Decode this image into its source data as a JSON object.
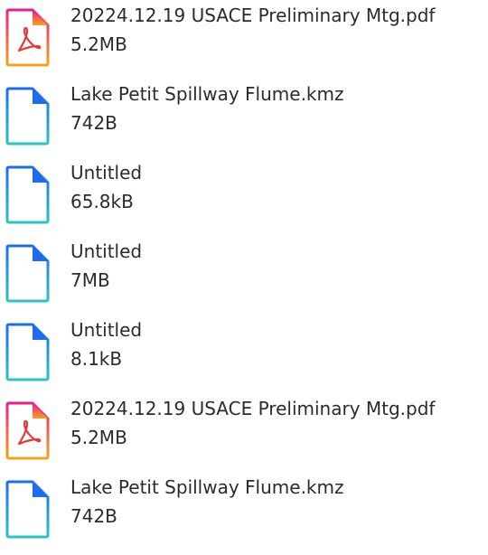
{
  "files": [
    {
      "name": "20224.12.19 USACE Preliminary Mtg.pdf",
      "size": "5.2MB",
      "icon": "pdf-file-icon"
    },
    {
      "name": "Lake Petit Spillway Flume.kmz",
      "size": "742B",
      "icon": "generic-file-icon"
    },
    {
      "name": "Untitled",
      "size": "65.8kB",
      "icon": "generic-file-icon"
    },
    {
      "name": "Untitled",
      "size": "7MB",
      "icon": "generic-file-icon"
    },
    {
      "name": "Untitled",
      "size": "8.1kB",
      "icon": "generic-file-icon"
    },
    {
      "name": "20224.12.19 USACE Preliminary Mtg.pdf",
      "size": "5.2MB",
      "icon": "pdf-file-icon"
    },
    {
      "name": "Lake Petit Spillway Flume.kmz",
      "size": "742B",
      "icon": "generic-file-icon"
    }
  ],
  "colors": {
    "pdf_gradient_top": "#e91e8c",
    "pdf_gradient_bottom": "#f7a21b",
    "pdf_glyph": "#e53935",
    "generic_gradient_top": "#1e6bf0",
    "generic_gradient_bottom": "#29c6c0",
    "text": "#2b2b2b"
  }
}
